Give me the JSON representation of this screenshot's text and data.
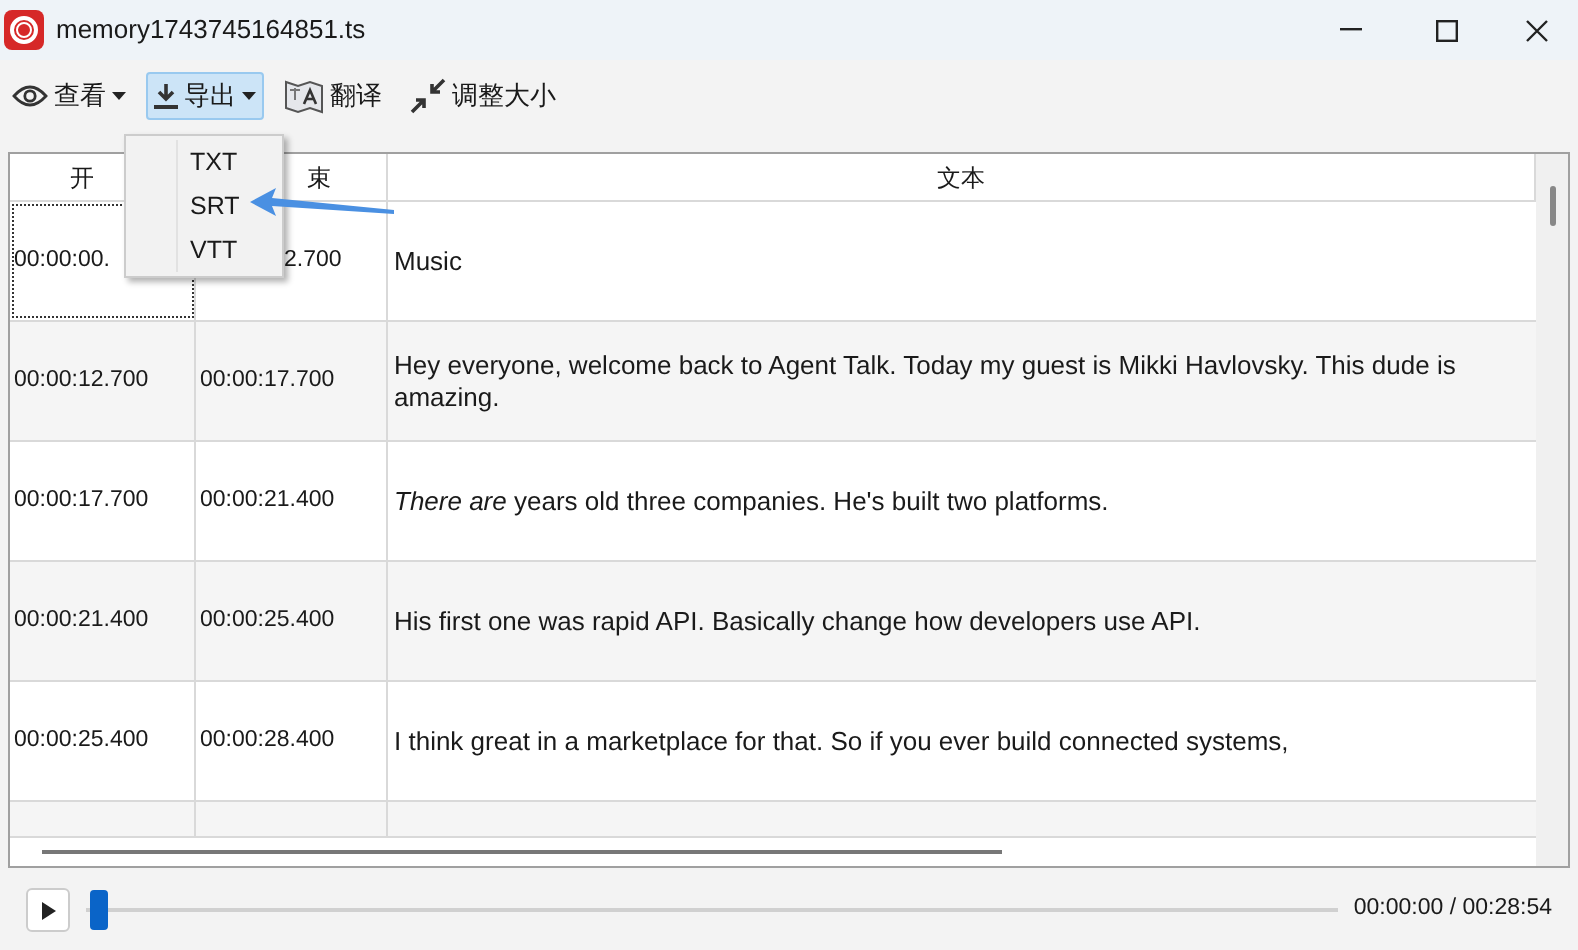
{
  "window": {
    "title": "memory1743745164851.ts"
  },
  "toolbar": [
    {
      "kind": "view",
      "label": "查看",
      "dropdown": true,
      "selected": false
    },
    {
      "kind": "export",
      "label": "导出",
      "dropdown": true,
      "selected": true
    },
    {
      "kind": "translate",
      "label": "翻译",
      "dropdown": false,
      "selected": false
    },
    {
      "kind": "resize",
      "label": "调整大小",
      "dropdown": false,
      "selected": false
    }
  ],
  "export_menu": {
    "items": [
      "TXT",
      "SRT",
      "VTT"
    ]
  },
  "table": {
    "columns": [
      "开",
      "束",
      "文本"
    ],
    "rows": [
      {
        "start": "00:00:00.",
        "end": "2.700",
        "text": "Music",
        "focused": true
      },
      {
        "start": "00:00:12.700",
        "end": "00:00:17.700",
        "text": "Hey everyone, welcome back to Agent Talk. Today my guest is Mikki Havlovsky. This dude is amazing.",
        "focused": false
      },
      {
        "start": "00:00:17.700",
        "end": "00:00:21.400",
        "text": "*There are* years old three companies. He's built two platforms.",
        "focused": false
      },
      {
        "start": "00:00:21.400",
        "end": "00:00:25.400",
        "text": "His first one was rapid API. Basically change how developers use API.",
        "focused": false
      },
      {
        "start": "00:00:25.400",
        "end": "00:00:28.400",
        "text": "I think great in a marketplace for that. So if you ever build connected systems,",
        "focused": false
      }
    ]
  },
  "player": {
    "level": 0.01,
    "time": "00:00:00 / 00:28:54"
  }
}
